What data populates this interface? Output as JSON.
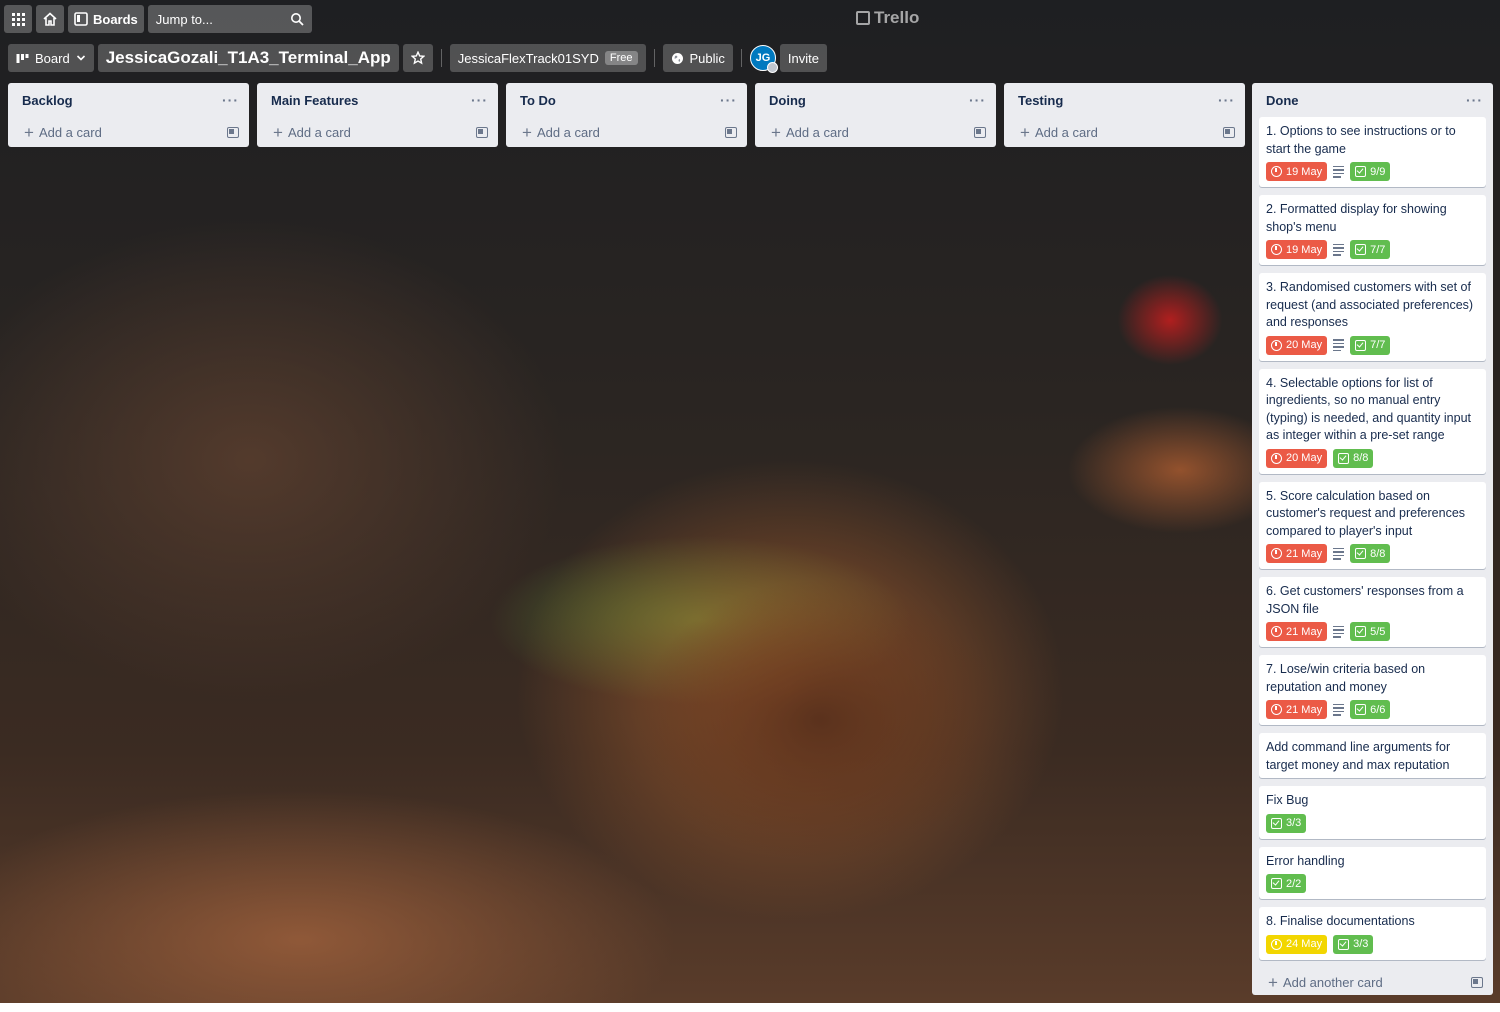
{
  "topnav": {
    "boards_label": "Boards",
    "jump_placeholder": "Jump to...",
    "logo": "Trello"
  },
  "boardbar": {
    "view_label": "Board",
    "board_title": "JessicaGozali_T1A3_Terminal_App",
    "workspace": "JessicaFlexTrack01SYD",
    "workspace_plan": "Free",
    "visibility": "Public",
    "avatar_initials": "JG",
    "invite_label": "Invite"
  },
  "lists": [
    {
      "title": "Backlog",
      "add_label": "Add a card"
    },
    {
      "title": "Main Features",
      "add_label": "Add a card"
    },
    {
      "title": "To Do",
      "add_label": "Add a card"
    },
    {
      "title": "Doing",
      "add_label": "Add a card"
    },
    {
      "title": "Testing",
      "add_label": "Add a card"
    }
  ],
  "done": {
    "title": "Done",
    "add_label": "Add another card",
    "cards": [
      {
        "title": "1. Options to see instructions or to start the game",
        "due": "19 May",
        "due_color": "#eb5a46",
        "has_desc": true,
        "checklist": "9/9"
      },
      {
        "title": "2. Formatted display for showing shop's menu",
        "due": "19 May",
        "due_color": "#eb5a46",
        "has_desc": true,
        "checklist": "7/7"
      },
      {
        "title": "3. Randomised customers with set of request (and associated preferences) and responses",
        "due": "20 May",
        "due_color": "#eb5a46",
        "has_desc": true,
        "checklist": "7/7"
      },
      {
        "title": "4. Selectable options for list of ingredients, so no manual entry (typing) is needed, and quantity input as integer within a pre-set range",
        "due": "20 May",
        "due_color": "#eb5a46",
        "has_desc": false,
        "checklist": "8/8"
      },
      {
        "title": "5. Score calculation based on customer's request and preferences compared to player's input",
        "due": "21 May",
        "due_color": "#eb5a46",
        "has_desc": true,
        "checklist": "8/8"
      },
      {
        "title": "6. Get customers' responses from a JSON file",
        "due": "21 May",
        "due_color": "#eb5a46",
        "has_desc": true,
        "checklist": "5/5"
      },
      {
        "title": "7. Lose/win criteria based on reputation and money",
        "due": "21 May",
        "due_color": "#eb5a46",
        "has_desc": true,
        "checklist": "6/6"
      },
      {
        "title": "Add command line arguments for target money and max reputation",
        "due": "",
        "has_desc": false,
        "checklist": ""
      },
      {
        "title": "Fix Bug",
        "due": "",
        "has_desc": false,
        "checklist": "3/3"
      },
      {
        "title": "Error handling",
        "due": "",
        "has_desc": false,
        "checklist": "2/2"
      },
      {
        "title": "8. Finalise documentations",
        "due": "24 May",
        "due_color": "#f2d600",
        "has_desc": false,
        "checklist": "3/3"
      }
    ]
  },
  "colors": {
    "list_bg": "#ebecf0",
    "overdue": "#eb5a46",
    "due_soon": "#f2d600",
    "complete": "#61bd4f"
  }
}
